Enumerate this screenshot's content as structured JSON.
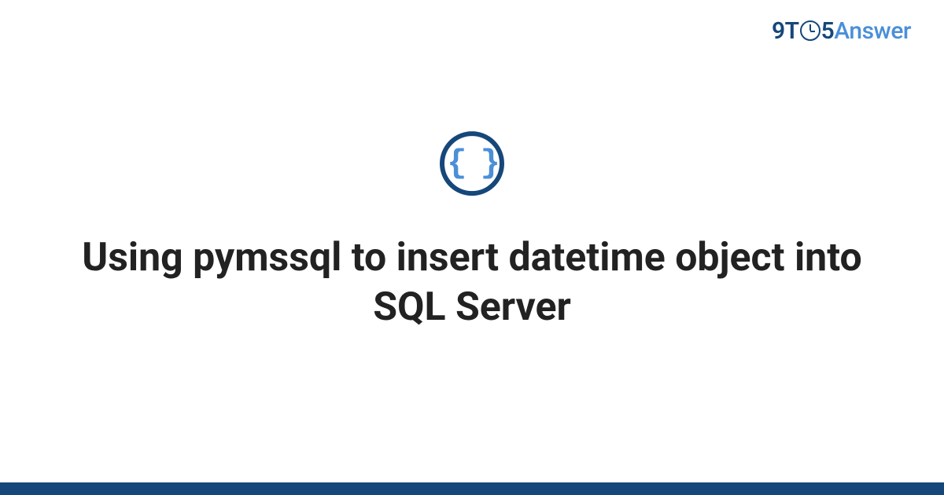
{
  "logo": {
    "part1": "9T",
    "part2": "5",
    "part3": "Answer"
  },
  "icon": {
    "braces": "{ }"
  },
  "title": "Using pymssql to insert datetime object into SQL Server",
  "colors": {
    "primary": "#16477a",
    "accent": "#4a8fd8",
    "text": "#222222"
  }
}
